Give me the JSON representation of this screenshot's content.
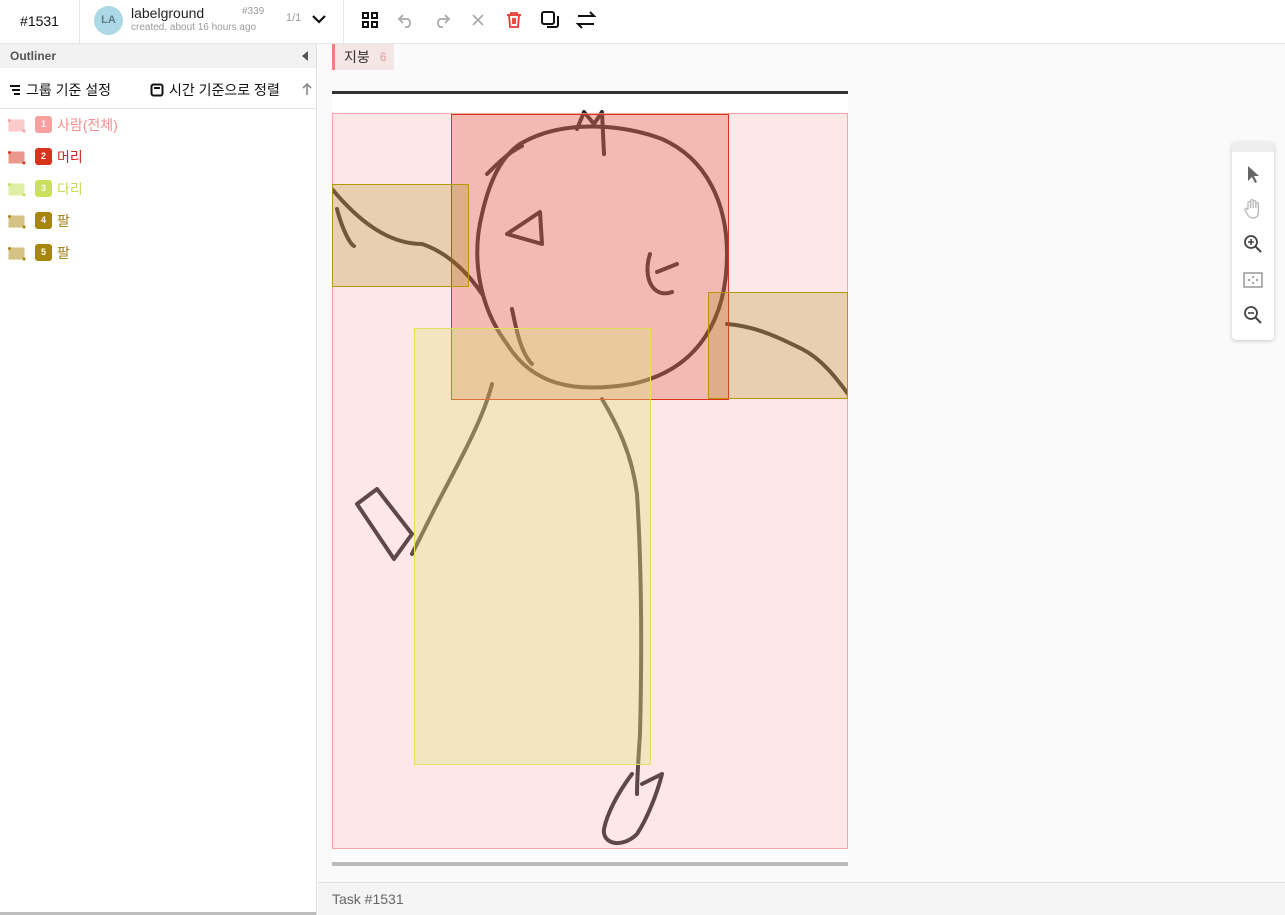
{
  "header": {
    "task_id": "#1531",
    "user": {
      "initials": "LA",
      "name": "labelground",
      "sub": "created, about 16 hours ago",
      "annotation_no": "#339"
    },
    "page_count": "1/1"
  },
  "toolbar": {
    "tools": [
      "grid-icon",
      "undo-icon",
      "redo-icon",
      "close-icon",
      "delete-icon",
      "copy-icon",
      "swap-icon"
    ],
    "delete_color": "#e53935"
  },
  "outliner": {
    "title": "Outliner",
    "group_label": "그룹 기준 설정",
    "time_label": "시간 기준으로 정렬",
    "items": [
      {
        "num": "1",
        "label": "사람(전체)",
        "color": "#f8a0a0"
      },
      {
        "num": "2",
        "label": "머리",
        "color": "#d9341b"
      },
      {
        "num": "3",
        "label": "다리",
        "color": "#c8e05a"
      },
      {
        "num": "4",
        "label": "팔",
        "color": "#a8860b"
      },
      {
        "num": "5",
        "label": "팔",
        "color": "#a8860b"
      }
    ]
  },
  "canvas": {
    "tag_label": "지붕",
    "tag_count": "6",
    "view_tools": [
      "pointer-icon",
      "hand-icon",
      "zoom-in-icon",
      "fit-icon",
      "zoom-out-icon"
    ]
  },
  "footer": {
    "text": "Task #1531"
  }
}
